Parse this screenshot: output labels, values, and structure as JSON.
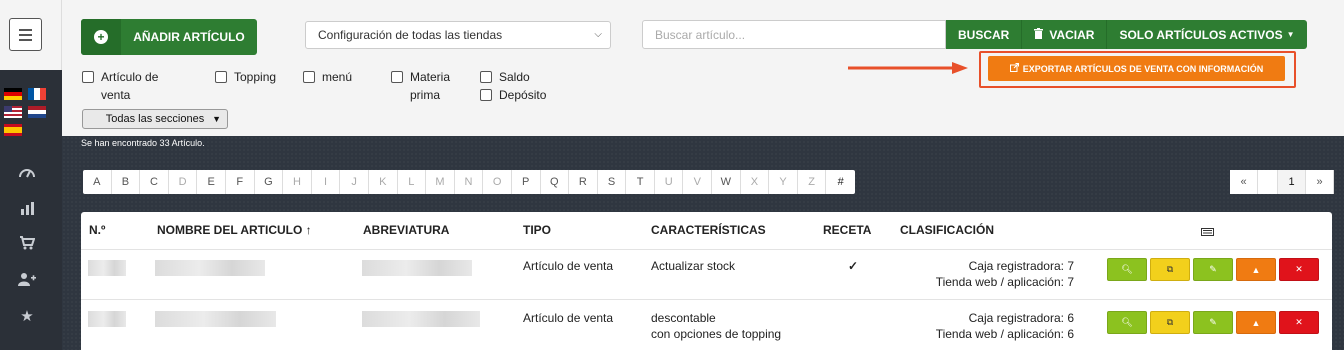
{
  "sidebar": {
    "menu_icon": "hamburger-icon",
    "flags": [
      "de",
      "fr",
      "us",
      "nl",
      "es"
    ],
    "nav_icons": [
      "dashboard-icon",
      "chart-icon",
      "cart-icon",
      "add-user-icon",
      "star-icon"
    ]
  },
  "toolbar": {
    "add_label": "AÑADIR ARTÍCULO",
    "store_select": "Configuración de todas las tiendas",
    "search_placeholder": "Buscar artículo...",
    "search_label": "BUSCAR",
    "clear_label": "VACIAR",
    "active_only_label": "SOLO ARTÍCULOS ACTIVOS",
    "export_label": "EXPORTAR ARTÍCULOS DE VENTA CON INFORMACIÓN"
  },
  "filters": {
    "sale_item_line1": "Artículo de",
    "sale_item_line2": "venta",
    "topping": "Topping",
    "menu": "menú",
    "raw_line1": "Materia",
    "raw_line2": "prima",
    "balance": "Saldo",
    "deposit": "Depósito",
    "sections": "Todas las secciones"
  },
  "results": {
    "found_text": "Se han encontrado 33 Artículo."
  },
  "alphabet": [
    "A",
    "B",
    "C",
    "D",
    "E",
    "F",
    "G",
    "H",
    "I",
    "J",
    "K",
    "L",
    "M",
    "N",
    "O",
    "P",
    "Q",
    "R",
    "S",
    "T",
    "U",
    "V",
    "W",
    "X",
    "Y",
    "Z",
    "#"
  ],
  "pager": {
    "prev": "«",
    "page": "1",
    "next": "»"
  },
  "table": {
    "headers": {
      "num": "N.º",
      "name": "NOMBRE DEL ARTICULO ↑",
      "abbr": "ABREVIATURA",
      "type": "TIPO",
      "features": "CARACTERÍSTICAS",
      "recipe": "RECETA",
      "classification": "CLASIFICACIÓN",
      "keyboard_icon": "keyboard-icon"
    },
    "rows": [
      {
        "type": "Artículo de venta",
        "features_1": "Actualizar stock",
        "features_2": "",
        "recipe": "✓",
        "class_1": "Caja registradora: 7",
        "class_2": "Tienda web / aplicación: 7"
      },
      {
        "type": "Artículo de venta",
        "features_1": "descontable",
        "features_2": "con opciones de topping",
        "recipe": "",
        "class_1": "Caja registradora: 6",
        "class_2": "Tienda web / aplicación: 6"
      }
    ]
  },
  "colors": {
    "green": "#2e7d32",
    "orange": "#f07b12",
    "highlight": "#e8502a",
    "dark_bg": "#2f3640"
  }
}
